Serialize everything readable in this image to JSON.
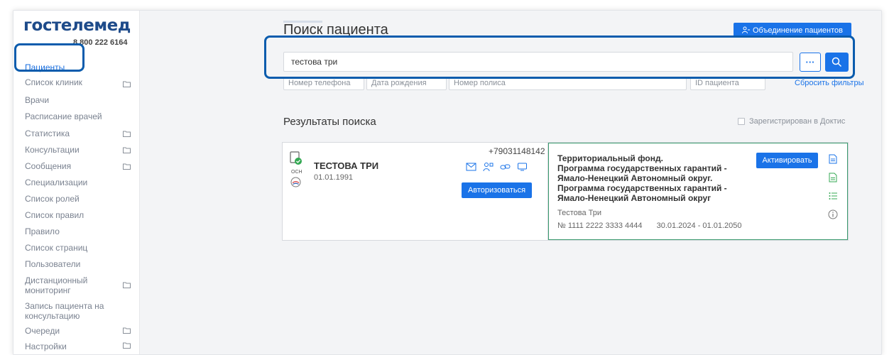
{
  "sidebar": {
    "logo": "гостелемед",
    "phone": "8 800 222 6164",
    "items": [
      {
        "label": "Пациенты",
        "folder": false,
        "active": true
      },
      {
        "label": "Список клиник",
        "folder": true
      },
      {
        "label": "Врачи",
        "folder": false
      },
      {
        "label": "Расписание врачей",
        "folder": false
      },
      {
        "label": "Статистика",
        "folder": true
      },
      {
        "label": "Консультации",
        "folder": true
      },
      {
        "label": "Сообщения",
        "folder": true
      },
      {
        "label": "Специализации",
        "folder": false
      },
      {
        "label": "Список ролей",
        "folder": false
      },
      {
        "label": "Список правил",
        "folder": false
      },
      {
        "label": "Правило",
        "folder": false
      },
      {
        "label": "Список страниц",
        "folder": false
      },
      {
        "label": "Пользователи",
        "folder": false
      },
      {
        "label": "Дистанционный мониторинг",
        "folder": true
      },
      {
        "label": "Запись пациента на консультацию",
        "folder": false
      },
      {
        "label": "Очереди",
        "folder": true
      },
      {
        "label": "Настройки",
        "folder": true
      }
    ]
  },
  "main": {
    "title": "Поиск пациента",
    "merge_button": "Объединение пациентов",
    "search_value": "тестова три",
    "more_label": "···",
    "filters": {
      "phone_placeholder": "Номер телефона",
      "dob_placeholder": "Дата рождения",
      "policy_placeholder": "Номер полиса",
      "id_placeholder": "ID пациента",
      "reset": "Сбросить фильтры",
      "doctis": "Зарегистрирован в Доктис"
    },
    "results_title": "Результаты поиска",
    "result": {
      "name": "ТЕСТОВА ТРИ",
      "dob": "01.01.1991",
      "phone": "+79031148142",
      "badge": "ОСН",
      "authorize": "Авторизоваться",
      "fund_lines": [
        "Территориальный фонд.",
        "Программа государственных гарантий -",
        "Ямало-Ненецкий Автономный округ.",
        "Программа государственных гарантий -",
        "Ямало-Ненецкий Автономный округ"
      ],
      "fund_person": "Тестова Три",
      "fund_policy": "№ 1111 2222 3333 4444",
      "fund_period": "30.01.2024 - 01.01.2050",
      "activate": "Активировать"
    }
  },
  "colors": {
    "accent": "#1a73e8",
    "logo": "#1e4b8a",
    "highlight": "#0b5cad",
    "policy_border": "#3a9a6e"
  }
}
